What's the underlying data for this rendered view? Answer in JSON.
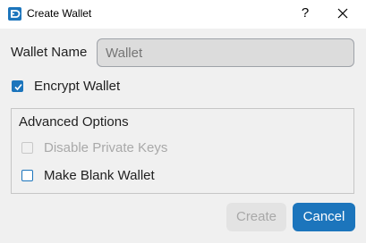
{
  "window": {
    "title": "Create Wallet",
    "help_glyph": "?",
    "close_glyph": "✕"
  },
  "form": {
    "name_label": "Wallet Name",
    "name_placeholder": "Wallet",
    "name_value": "",
    "encrypt_label": "Encrypt Wallet",
    "encrypt_checked": true
  },
  "advanced": {
    "title": "Advanced Options",
    "disable_private_keys_label": "Disable Private Keys",
    "disable_private_keys_checked": false,
    "disable_private_keys_enabled": false,
    "blank_wallet_label": "Make Blank Wallet",
    "blank_wallet_checked": false
  },
  "buttons": {
    "create_label": "Create",
    "create_enabled": false,
    "cancel_label": "Cancel"
  },
  "colors": {
    "accent": "#1c75bc",
    "background": "#f0f0f0"
  }
}
